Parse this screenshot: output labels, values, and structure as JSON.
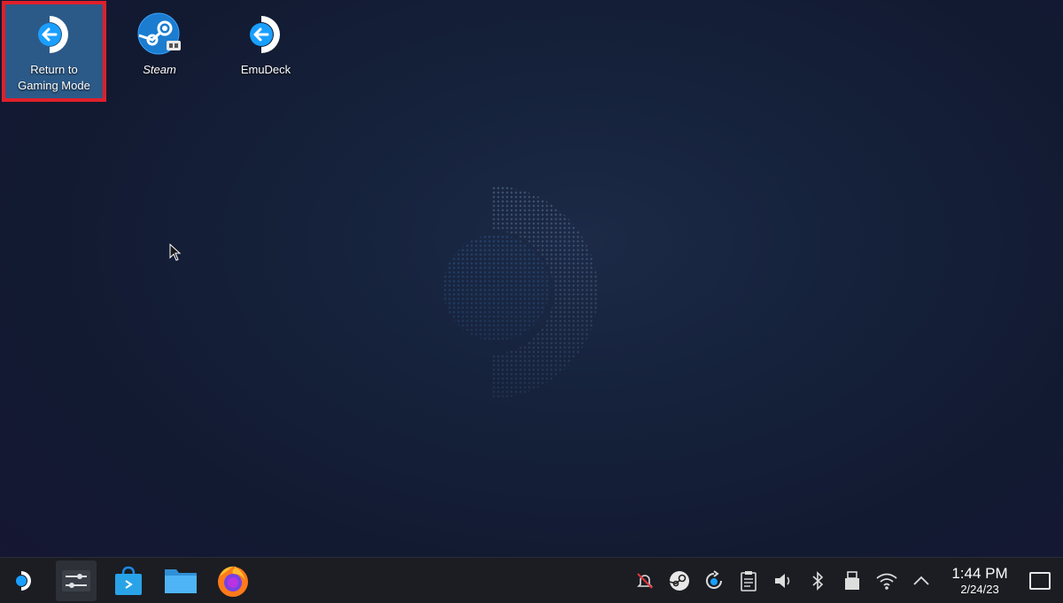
{
  "desktop": {
    "icons": [
      {
        "label": "Return to Gaming Mode",
        "icon": "return-arrow-icon"
      },
      {
        "label": "Steam",
        "icon": "steam-icon"
      },
      {
        "label": "EmuDeck",
        "icon": "return-arrow-icon"
      }
    ]
  },
  "taskbar": {
    "launchers": [
      "application-launcher",
      "system-settings",
      "discover-store",
      "file-manager",
      "firefox"
    ],
    "tray": [
      "notifications-muted-icon",
      "steam-tray-icon",
      "update-icon",
      "clipboard-icon",
      "volume-icon",
      "bluetooth-icon",
      "storage-icon",
      "wifi-icon",
      "expand-tray-icon"
    ],
    "clock": {
      "time": "1:44 PM",
      "date": "2/24/23"
    }
  },
  "colors": {
    "accent": "#2c5a88",
    "highlight_border": "#e0202a",
    "taskbar_bg": "#1b1d22",
    "logo_blue": "#1a9fff"
  }
}
